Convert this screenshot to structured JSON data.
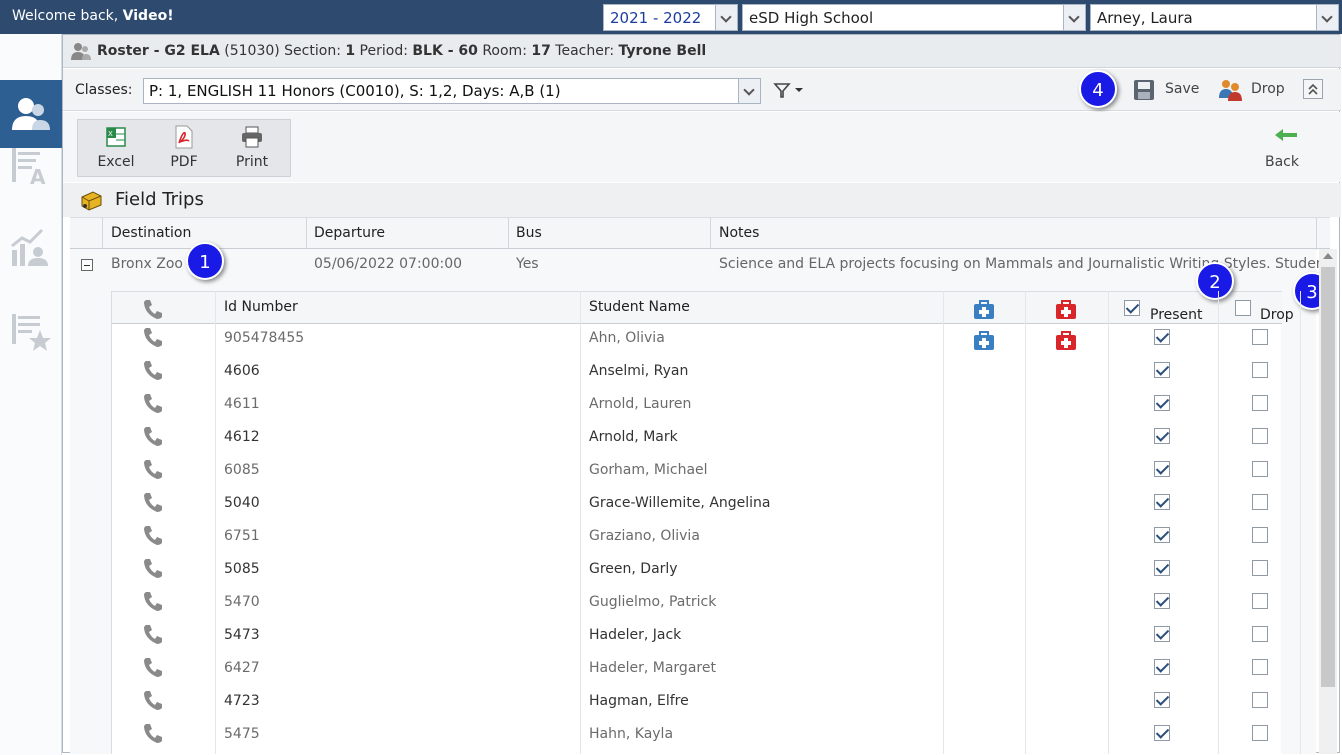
{
  "topbar": {
    "welcome_prefix": "Welcome back, ",
    "welcome_name": "Video!",
    "year": "2021 - 2022",
    "school": "eSD High School",
    "user": "Arney, Laura"
  },
  "header": {
    "label_roster": "Roster - G2 ELA",
    "code": " (51030) Section: ",
    "section": "1",
    "period_label": " Period: ",
    "period": "BLK - 60",
    "room_label": " Room: ",
    "room": "17",
    "teacher_label": " Teacher: ",
    "teacher": "Tyrone Bell"
  },
  "classes": {
    "label": "Classes:",
    "value": "P: 1, ENGLISH 11 Honors (C0010), S: 1,2, Days: A,B (1)"
  },
  "toolbar": {
    "save_label": "Save",
    "drop_label": "Drop",
    "back_label": "Back"
  },
  "export": {
    "excel": "Excel",
    "pdf": "PDF",
    "print": "Print"
  },
  "section_title": "Field Trips",
  "grid": {
    "columns": [
      "Destination",
      "Departure",
      "Bus",
      "Notes"
    ],
    "row": {
      "destination": "Bronx Zoo",
      "departure": "05/06/2022 07:00:00",
      "bus": "Yes",
      "notes": "Science and ELA projects focusing on Mammals and Journalistic Writing Styles. Studen..."
    }
  },
  "subgrid": {
    "columns": {
      "id": "Id Number",
      "name": "Student Name",
      "present": "Present",
      "drop": "Drop"
    },
    "students": [
      {
        "id": "905478455",
        "name": "Ahn, Olivia",
        "present": true,
        "drop": false,
        "medical": true
      },
      {
        "id": "4606",
        "name": "Anselmi, Ryan",
        "present": true,
        "drop": false,
        "medical": false
      },
      {
        "id": "4611",
        "name": "Arnold, Lauren",
        "present": true,
        "drop": false,
        "medical": false
      },
      {
        "id": "4612",
        "name": "Arnold, Mark",
        "present": true,
        "drop": false,
        "medical": false
      },
      {
        "id": "6085",
        "name": "Gorham, Michael",
        "present": true,
        "drop": false,
        "medical": false
      },
      {
        "id": "5040",
        "name": "Grace-Willemite, Angelina",
        "present": true,
        "drop": false,
        "medical": false
      },
      {
        "id": "6751",
        "name": "Graziano, Olivia",
        "present": true,
        "drop": false,
        "medical": false
      },
      {
        "id": "5085",
        "name": "Green, Darly",
        "present": true,
        "drop": false,
        "medical": false
      },
      {
        "id": "5470",
        "name": "Guglielmo, Patrick",
        "present": true,
        "drop": false,
        "medical": false
      },
      {
        "id": "5473",
        "name": "Hadeler, Jack",
        "present": true,
        "drop": false,
        "medical": false
      },
      {
        "id": "6427",
        "name": "Hadeler, Margaret",
        "present": true,
        "drop": false,
        "medical": false
      },
      {
        "id": "4723",
        "name": "Hagman, Elfre",
        "present": true,
        "drop": false,
        "medical": false
      },
      {
        "id": "5475",
        "name": "Hahn, Kayla",
        "present": true,
        "drop": false,
        "medical": false
      }
    ]
  },
  "callouts": [
    "1",
    "2",
    "3",
    "4"
  ],
  "colors": {
    "topbar": "#2e4b6f",
    "callout": "#1a1ae6",
    "nurse_blue": "#3a7fc2",
    "nurse_red": "#d9262b"
  }
}
